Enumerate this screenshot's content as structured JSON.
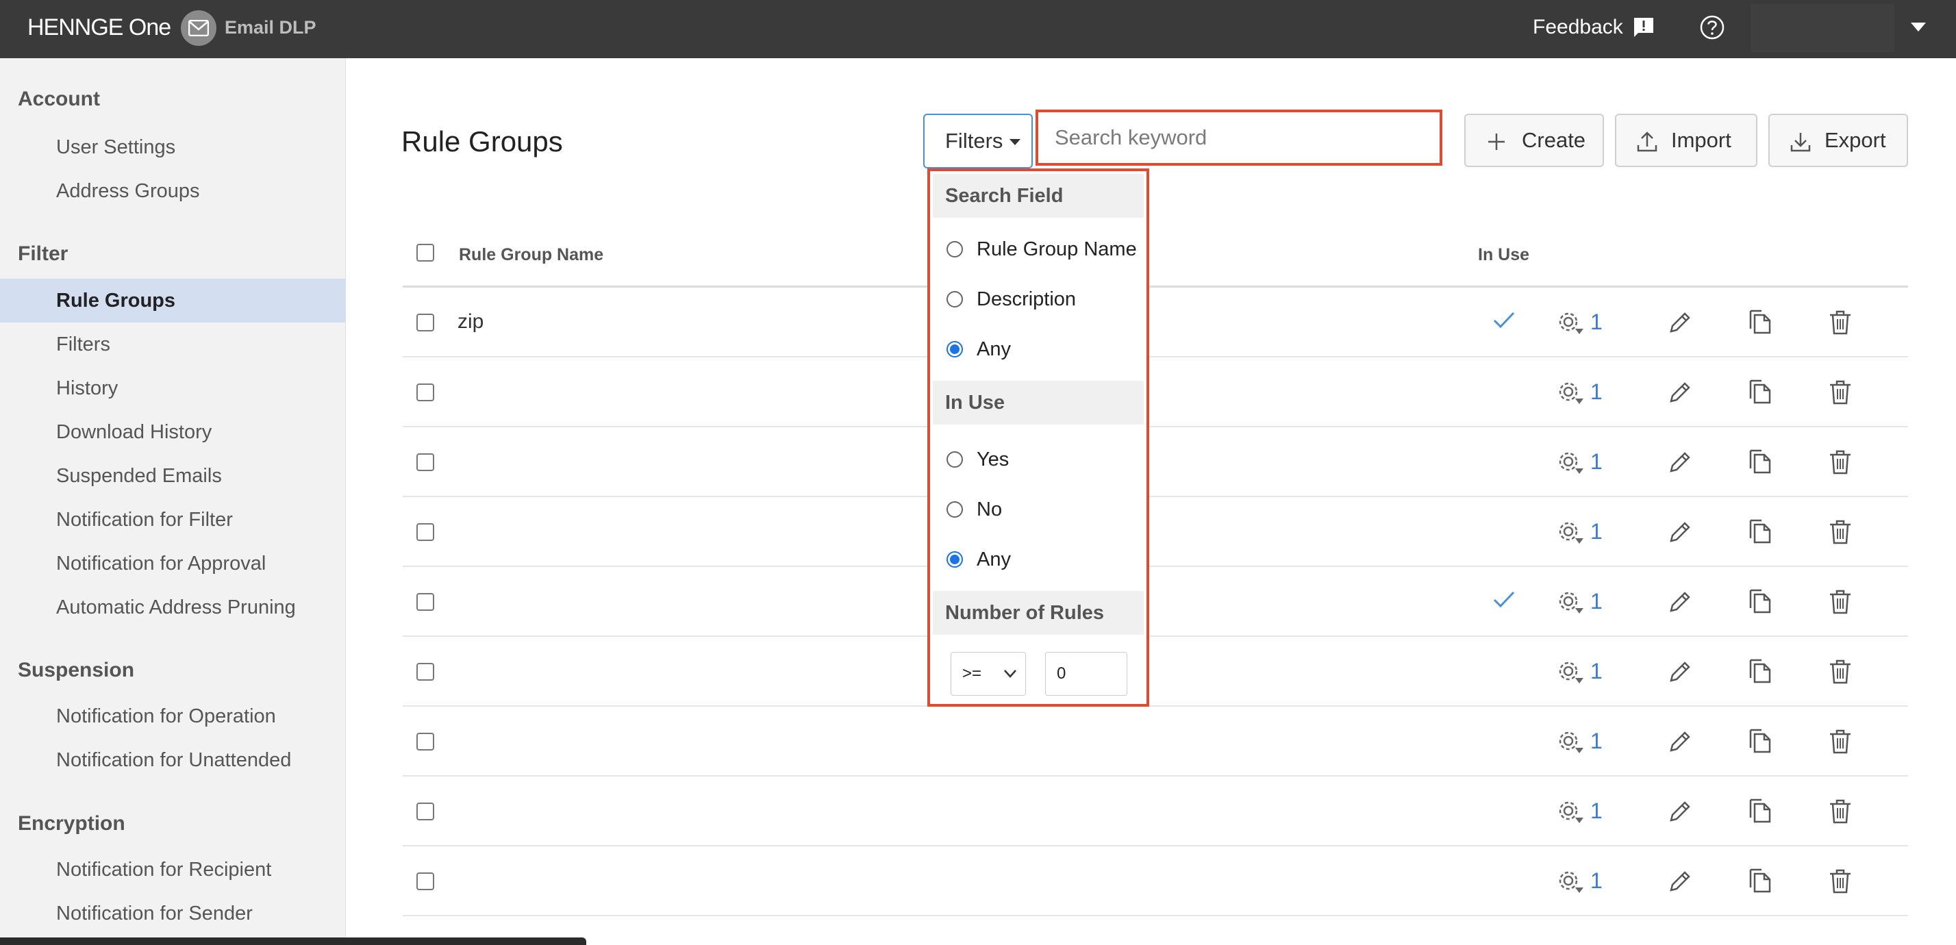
{
  "topbar": {
    "brand": "HENNGE One",
    "product": "Email DLP",
    "feedback_label": "Feedback"
  },
  "sidebar": {
    "sections": [
      {
        "title": "Account",
        "items": [
          "User Settings",
          "Address Groups"
        ]
      },
      {
        "title": "Filter",
        "items": [
          "Rule Groups",
          "Filters",
          "History",
          "Download History",
          "Suspended Emails",
          "Notification for Filter",
          "Notification for Approval",
          "Automatic Address Pruning"
        ]
      },
      {
        "title": "Suspension",
        "items": [
          "Notification for Operation",
          "Notification for Unattended"
        ]
      },
      {
        "title": "Encryption",
        "items": [
          "Notification for Recipient",
          "Notification for Sender"
        ]
      }
    ],
    "active_item": "Rule Groups"
  },
  "main": {
    "page_title": "Rule Groups",
    "filters_label": "Filters",
    "search_placeholder": "Search keyword",
    "buttons": {
      "create": "Create",
      "import": "Import",
      "export": "Export"
    }
  },
  "table": {
    "columns": {
      "name": "Rule Group Name",
      "in_use": "In Use"
    },
    "rows": [
      {
        "name": "zip",
        "in_use": true,
        "rules": "1"
      },
      {
        "name": "",
        "in_use": false,
        "rules": "1"
      },
      {
        "name": "",
        "in_use": false,
        "rules": "1"
      },
      {
        "name": "",
        "in_use": false,
        "rules": "1"
      },
      {
        "name": "",
        "in_use": true,
        "rules": "1"
      },
      {
        "name": "",
        "in_use": false,
        "rules": "1"
      },
      {
        "name": "",
        "in_use": false,
        "rules": "1"
      },
      {
        "name": "",
        "in_use": false,
        "rules": "1"
      },
      {
        "name": "",
        "in_use": false,
        "rules": "1"
      }
    ]
  },
  "filter_panel": {
    "search_field": {
      "title": "Search Field",
      "options": [
        "Rule Group Name",
        "Description",
        "Any"
      ],
      "selected": "Any"
    },
    "in_use": {
      "title": "In Use",
      "options": [
        "Yes",
        "No",
        "Any"
      ],
      "selected": "Any"
    },
    "number_of_rules": {
      "title": "Number of Rules",
      "operator": ">=",
      "value": "0"
    }
  },
  "colors": {
    "topbar": "#3a3a3a",
    "highlight": "#e04a2f",
    "active_sidebar": "#d3dff0",
    "link": "#3a7bd5"
  }
}
